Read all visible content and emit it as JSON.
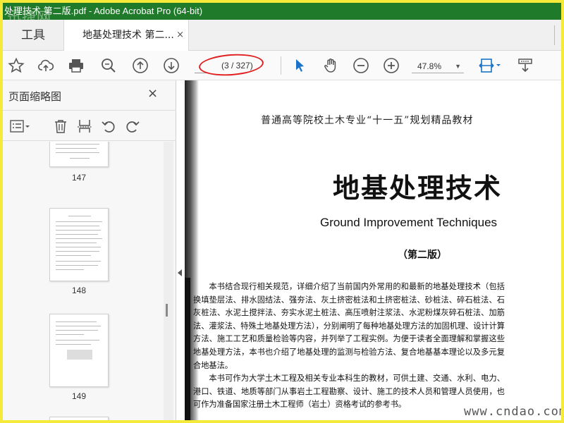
{
  "window": {
    "title": "处理技术 第二版.pdf - Adobe Acrobat Pro (64-bit)",
    "watermark": "迅捷网"
  },
  "tabs": {
    "tools_label": "工具",
    "doc_label": "地基处理技术 第二...",
    "close_glyph": "×"
  },
  "toolbar": {
    "icons": [
      "star-icon",
      "cloud-upload-icon",
      "print-icon",
      "zoom-search-icon",
      "prev-page-icon",
      "next-page-icon",
      "select-pointer-icon",
      "hand-icon",
      "zoom-out-icon",
      "zoom-in-icon",
      "fit-page-icon",
      "scroll-mode-icon"
    ],
    "page_input": "3",
    "page_count": "(3 / 327)",
    "zoom_value": "47.8%"
  },
  "sidebar": {
    "title": "页面缩略图",
    "close_glyph": "×",
    "thumbnails": [
      {
        "label": "147"
      },
      {
        "label": "148"
      },
      {
        "label": "149"
      }
    ]
  },
  "document": {
    "series": "普通高等院校土木专业“十一五”规划精品教材",
    "title": "地基处理技术",
    "subtitle_en": "Ground Improvement Techniques",
    "edition": "（第二版）",
    "para1": "本书结合现行相关规范，详细介绍了当前国内外常用的和最新的地基处理技术（包括换填垫层法、排水固结法、强夯法、灰土挤密桩法和土挤密桩法、砂桩法、碎石桩法、石灰桩法、水泥土搅拌法、夯实水泥土桩法、高压喷射注浆法、水泥粉煤灰碎石桩法、加筋法、灌浆法、特殊土地基处理方法），分别阐明了每种地基处理方法的加固机理、设计计算方法、施工工艺和质量检验等内容，并列举了工程实例。为便于读者全面理解和掌握这些地基处理方法，本书也介绍了地基处理的监测与检验方法、复合地基基本理论以及多元复合地基法。",
    "para2": "本书可作为大学土木工程及相关专业本科生的教材，可供土建、交通、水利、电力、港口、铁道、地质等部门从事岩土工程勘察、设计、施工的技术人员和管理人员使用，也可作为准备国家注册土木工程师（岩土）资格考试的参考书。",
    "site_watermark": "www.cndao.com"
  },
  "colors": {
    "titlebar": "#1f7a2a",
    "accent_blue": "#1a73c8",
    "annotation_red": "#e02020",
    "frame": "#f5e93a"
  }
}
